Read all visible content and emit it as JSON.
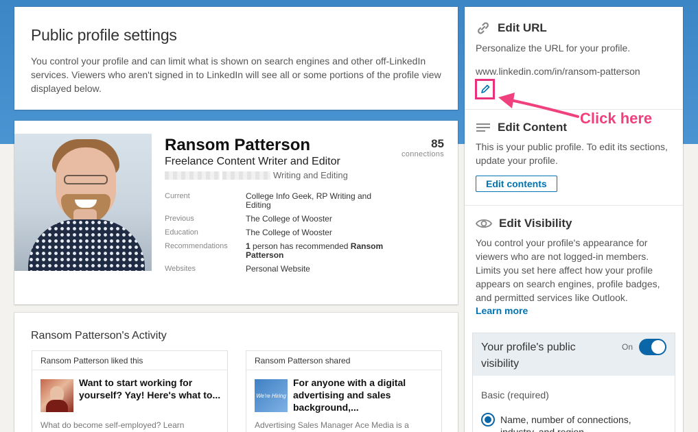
{
  "settings": {
    "title": "Public profile settings",
    "description": "You control your profile and can limit what is shown on search engines and other off-LinkedIn services. Viewers who aren't signed in to LinkedIn will see all or some portions of the profile view displayed below."
  },
  "profile": {
    "name": "Ransom Patterson",
    "headline": "Freelance Content Writer and Editor",
    "location": "Writing and Editing",
    "connections_count": "85",
    "connections_label": "connections",
    "rows": [
      {
        "label": "Current",
        "value": "College Info Geek, RP Writing and Editing"
      },
      {
        "label": "Previous",
        "value": "The College of Wooster"
      },
      {
        "label": "Education",
        "value": "The College of Wooster"
      },
      {
        "label": "Recommendations",
        "value_bold1": "1",
        "value_mid": " person has recommended ",
        "value_bold2": "Ransom Patterson"
      },
      {
        "label": "Websites",
        "value": "Personal Website"
      }
    ]
  },
  "activity": {
    "title": "Ransom Patterson's Activity",
    "items": [
      {
        "header": "Ransom Patterson liked this",
        "title": "Want to start working for yourself? Yay! Here's what to...",
        "snippet": "What do become self-employed? Learn"
      },
      {
        "header": "Ransom Patterson shared",
        "title": "For anyone with a digital advertising and sales background,...",
        "snippet": "Advertising Sales Manager Ace Media is a",
        "thumb_text": "We're Hiring"
      }
    ]
  },
  "right": {
    "url_title": "Edit URL",
    "url_desc": "Personalize the URL for your profile.",
    "url_value": "www.linkedin.com/in/ransom-patterson",
    "content_title": "Edit Content",
    "content_desc": "This is your public profile. To edit its sections, update your profile.",
    "content_button": "Edit contents",
    "visibility_title": "Edit Visibility",
    "visibility_desc": "You control your profile's appearance for viewers who are not logged-in members. Limits you set here affect how your profile appears on search engines, profile badges, and permitted services like Outlook.",
    "learn_more": "Learn more",
    "public_visibility_label": "Your profile's public visibility",
    "toggle_state": "On",
    "basic_label": "Basic (required)",
    "basic_option": "Name, number of connections, industry, and region"
  },
  "annotation": {
    "text": "Click here",
    "color": "#e8317a"
  },
  "colors": {
    "brand": "#0073b1",
    "banner": "#4a94d2"
  }
}
